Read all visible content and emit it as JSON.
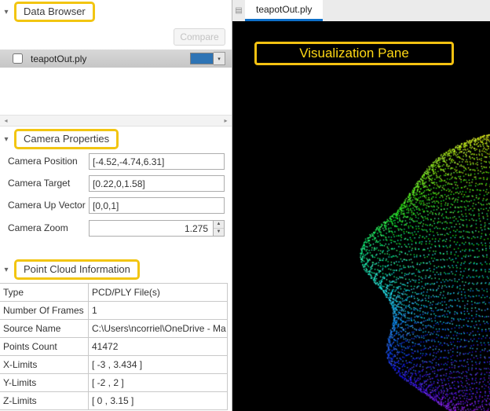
{
  "annotation_color": "#f2c511",
  "icons": {
    "collapse": "▾",
    "dropdown": "▾",
    "scroll_left": "◂",
    "scroll_right": "▸",
    "spin_up": "▲",
    "spin_down": "▼",
    "docs": "▤"
  },
  "data_browser": {
    "title": "Data Browser",
    "compare_label": "Compare",
    "files": [
      {
        "name": "teapotOut.ply",
        "checked": false,
        "swatch_color": "#2e74b5"
      }
    ]
  },
  "camera_properties": {
    "title": "Camera Properties",
    "fields": [
      {
        "label": "Camera Position",
        "value": "[-4.52,-4.74,6.31]"
      },
      {
        "label": "Camera Target",
        "value": "[0.22,0,1.58]"
      },
      {
        "label": "Camera Up Vector",
        "value": "[0,0,1]"
      },
      {
        "label": "Camera Zoom",
        "value": "1.275"
      }
    ]
  },
  "point_cloud_information": {
    "title": "Point Cloud Information",
    "rows": [
      {
        "label": "Type",
        "value": "PCD/PLY File(s)"
      },
      {
        "label": "Number Of Frames",
        "value": "1"
      },
      {
        "label": "Source Name",
        "value": "C:\\Users\\ncorriel\\OneDrive - Ma"
      },
      {
        "label": "Points Count",
        "value": "41472"
      },
      {
        "label": "X-Limits",
        "value": "[ -3 , 3.434 ]"
      },
      {
        "label": "Y-Limits",
        "value": "[ -2 , 2 ]"
      },
      {
        "label": "Z-Limits",
        "value": "[ 0 , 3.15 ]"
      }
    ]
  },
  "visualization": {
    "tab_label": "teapotOut.ply",
    "pane_label": "Visualization Pane",
    "background": "#000000"
  }
}
